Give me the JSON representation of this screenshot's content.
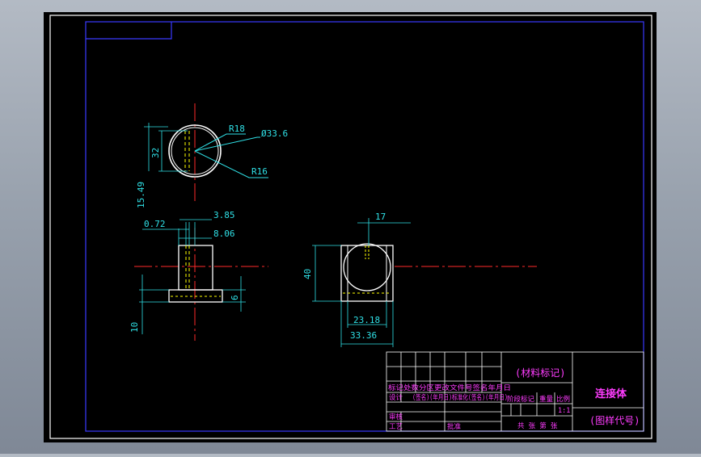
{
  "colors": {
    "background": "#000000",
    "border": "#ffffff",
    "frame": "#3a3aff",
    "outline": "#ffffff",
    "centerline": "#ff2a2a",
    "dimension": "#2fe0e6",
    "hidden": "#ffff00",
    "title_text": "#ff3cff"
  },
  "top_view": {
    "radius_outer": "R18",
    "diameter": "Ø33.6",
    "radius_inner": "R16",
    "height_dim": "32",
    "offset_dim": "15.49"
  },
  "front_view": {
    "dim_top_small": "0.72",
    "dim_top_mid": "3.85",
    "dim_top_wide": "8.06",
    "dim_base_height": "6",
    "dim_total_height": "10"
  },
  "side_view": {
    "dim_slot": "17",
    "dim_height": "40",
    "dim_width_inner": "23.18",
    "dim_width_outer": "33.36"
  },
  "title_block": {
    "material": "(材料标记)",
    "part_name": "连接体",
    "drawing_code": "(图样代号)",
    "row_revision": "标记处数分区更改文件号签名年月日",
    "row_design": "设计",
    "row_standard": "(签名)(年月日)标准化(签名)(年月日)",
    "col_stage": "阶段标记",
    "col_weight": "重量",
    "col_scale": "比例",
    "scale_value": "1:1",
    "label_review": "审核",
    "label_process": "工艺",
    "label_approve": "批准",
    "sheets": "共 张 第 张"
  }
}
